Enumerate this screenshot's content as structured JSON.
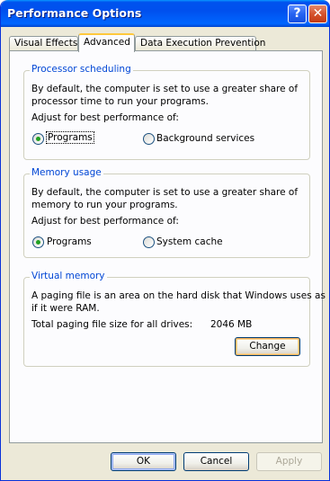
{
  "window": {
    "title": "Performance Options",
    "help_glyph": "?",
    "close_glyph": "✕"
  },
  "tabs": [
    {
      "label": "Visual Effects",
      "active": false
    },
    {
      "label": "Advanced",
      "active": true
    },
    {
      "label": "Data Execution Prevention",
      "active": false
    }
  ],
  "processor": {
    "legend": "Processor scheduling",
    "description_line1": "By default, the computer is set to use a greater share of",
    "description_line2": "processor time to run your programs.",
    "adjust_label": "Adjust for best performance of:",
    "option_programs": "Programs",
    "option_background": "Background services",
    "selected": "Programs"
  },
  "memory": {
    "legend": "Memory usage",
    "description_line1": "By default, the computer is set to use a greater share of",
    "description_line2": "memory to run your programs.",
    "adjust_label": "Adjust for best performance of:",
    "option_programs": "Programs",
    "option_cache": "System cache",
    "selected": "Programs"
  },
  "virtual_memory": {
    "legend": "Virtual memory",
    "description_line1": "A paging file is an area on the hard disk that Windows uses as",
    "description_line2": "if it were RAM.",
    "total_label": "Total paging file size for all drives:",
    "total_value": "2046 MB",
    "change_button": "Change"
  },
  "footer": {
    "ok": "OK",
    "cancel": "Cancel",
    "apply": "Apply"
  },
  "colors": {
    "titlebar": "#0055ea",
    "legend_text": "#0046d5",
    "radio_dot": "#21a121"
  }
}
